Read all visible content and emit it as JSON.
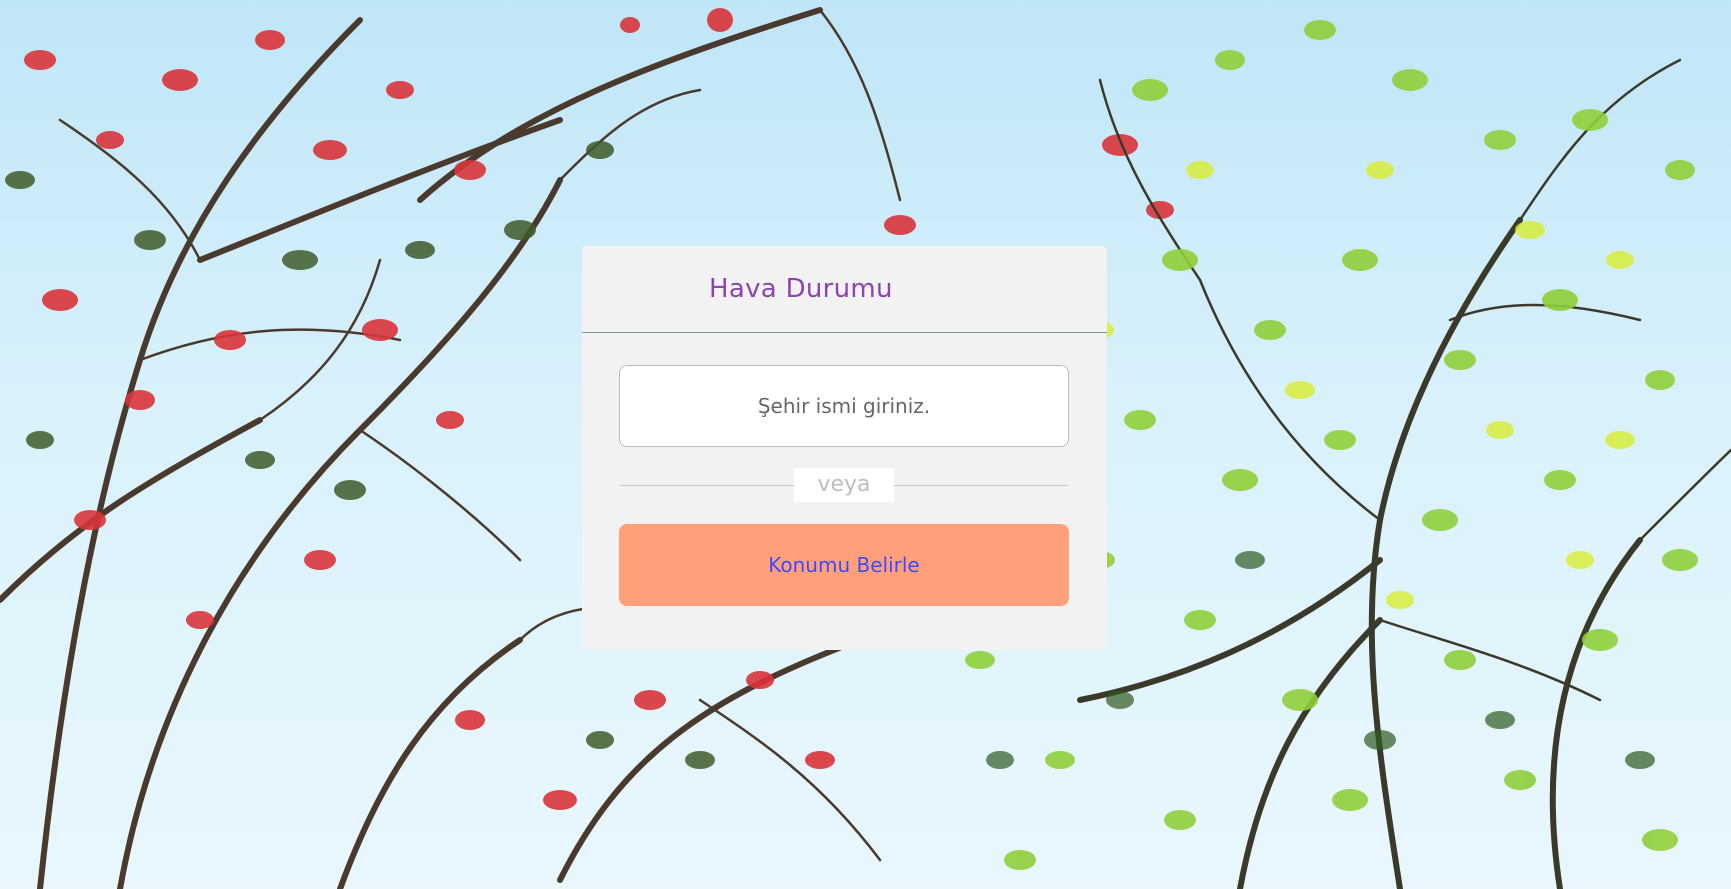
{
  "card": {
    "title": "Hava Durumu",
    "city_input_placeholder": "Şehir ismi giriniz.",
    "divider_label": "veya",
    "locate_button_label": "Konumu Belirle"
  },
  "colors": {
    "title": "#8e44ad",
    "button_bg": "#ffa07a",
    "button_text": "#3d4bff",
    "card_bg": "#f2f2f2"
  }
}
